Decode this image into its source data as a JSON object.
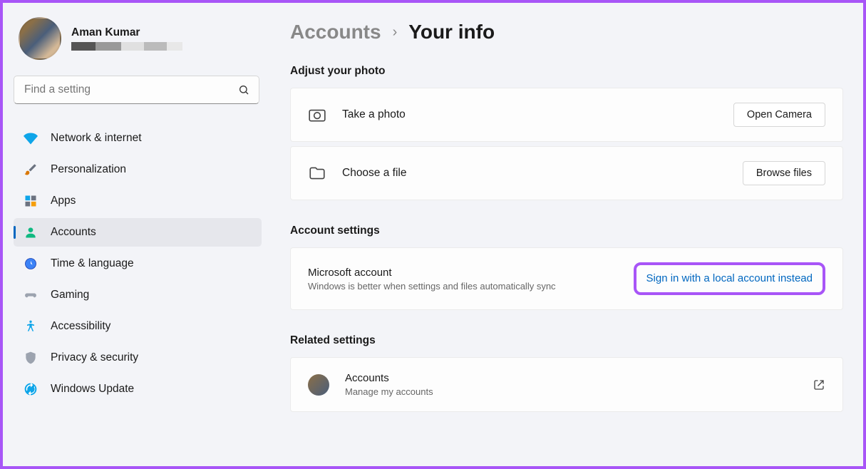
{
  "profile": {
    "name": "Aman Kumar"
  },
  "search": {
    "placeholder": "Find a setting"
  },
  "nav": {
    "network": "Network & internet",
    "personalization": "Personalization",
    "apps": "Apps",
    "accounts": "Accounts",
    "time": "Time & language",
    "gaming": "Gaming",
    "accessibility": "Accessibility",
    "privacy": "Privacy & security",
    "update": "Windows Update"
  },
  "breadcrumb": {
    "parent": "Accounts",
    "current": "Your info"
  },
  "sections": {
    "photo": {
      "title": "Adjust your photo",
      "take_photo": "Take a photo",
      "open_camera": "Open Camera",
      "choose_file": "Choose a file",
      "browse_files": "Browse files"
    },
    "account": {
      "title": "Account settings",
      "ms_account": "Microsoft account",
      "ms_desc": "Windows is better when settings and files automatically sync",
      "local_link": "Sign in with a local account instead"
    },
    "related": {
      "title": "Related settings",
      "accounts": "Accounts",
      "accounts_desc": "Manage my accounts"
    }
  }
}
